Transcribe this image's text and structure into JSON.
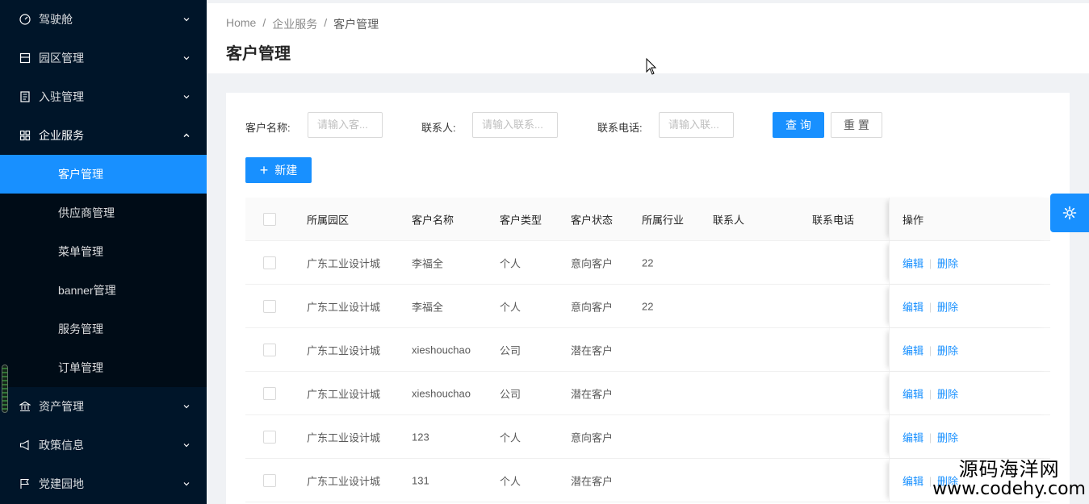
{
  "sidebar": {
    "menus": [
      {
        "label": "驾驶舱",
        "icon": "dashboard-icon"
      },
      {
        "label": "园区管理",
        "icon": "park-icon"
      },
      {
        "label": "入驻管理",
        "icon": "checkin-icon"
      },
      {
        "label": "企业服务",
        "icon": "apps-icon"
      }
    ],
    "submenu": [
      "客户管理",
      "供应商管理",
      "菜单管理",
      "banner管理",
      "服务管理",
      "订单管理"
    ],
    "menus_after": [
      {
        "label": "资产管理",
        "icon": "bank-icon"
      },
      {
        "label": "政策信息",
        "icon": "notification-icon"
      },
      {
        "label": "党建园地",
        "icon": "flag-icon"
      }
    ]
  },
  "breadcrumb": {
    "home": "Home",
    "level1": "企业服务",
    "current": "客户管理",
    "sep": "/"
  },
  "page_title": "客户管理",
  "filters": {
    "name_label": "客户名称:",
    "name_placeholder": "请输入客...",
    "contact_label": "联系人:",
    "contact_placeholder": "请输入联系...",
    "phone_label": "联系电话:",
    "phone_placeholder": "请输入联...",
    "search_label": "查 询",
    "reset_label": "重 置"
  },
  "new_button": {
    "icon": "+",
    "label": "新建"
  },
  "table": {
    "headers": [
      "所属园区",
      "客户名称",
      "客户类型",
      "客户状态",
      "所属行业",
      "联系人",
      "联系电话",
      "操作"
    ],
    "rows": [
      [
        "广东工业设计城",
        "李福全",
        "个人",
        "意向客户",
        "22",
        "",
        ""
      ],
      [
        "广东工业设计城",
        "李福全",
        "个人",
        "意向客户",
        "22",
        "",
        ""
      ],
      [
        "广东工业设计城",
        "xieshouchao",
        "公司",
        "潜在客户",
        "",
        "",
        ""
      ],
      [
        "广东工业设计城",
        "xieshouchao",
        "公司",
        "潜在客户",
        "",
        "",
        ""
      ],
      [
        "广东工业设计城",
        "123",
        "个人",
        "意向客户",
        "",
        "",
        ""
      ],
      [
        "广东工业设计城",
        "131",
        "个人",
        "潜在客户",
        "",
        "",
        ""
      ]
    ],
    "action_edit": "编辑",
    "action_delete": "删除"
  },
  "watermark": {
    "cn": "源码海洋网",
    "en": "www.codehy.com"
  },
  "colors": {
    "primary": "#1890ff",
    "sidebar": "#001529"
  }
}
